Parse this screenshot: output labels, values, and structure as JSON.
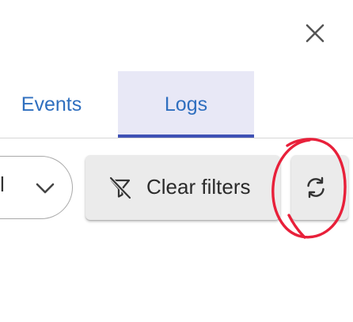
{
  "dialog": {
    "close_icon": "close-icon"
  },
  "tabs": [
    {
      "label": "Events",
      "selected": false
    },
    {
      "label": "Logs",
      "selected": true
    }
  ],
  "toolbar": {
    "select_value": "l",
    "select_icon": "chevron-down-icon",
    "clear_filters_label": "Clear filters",
    "clear_filters_icon": "filter-off-icon",
    "refresh_icon": "refresh-icon"
  },
  "annotation": {
    "type": "hand-drawn circle",
    "color": "#e8203a"
  },
  "colors": {
    "tab_text": "#2f6fbf",
    "tab_selected_bg": "#e8e8f6",
    "tab_indicator": "#3f51b5",
    "button_bg": "#ebebeb"
  }
}
